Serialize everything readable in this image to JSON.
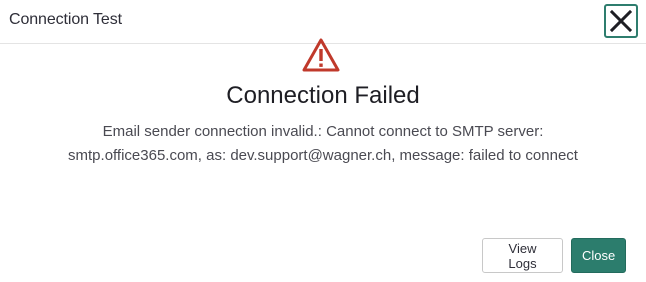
{
  "dialog": {
    "title": "Connection Test",
    "close_icon": "close-x-icon"
  },
  "status": {
    "icon": "warning-triangle-icon",
    "icon_color": "#c0392b",
    "heading": "Connection Failed",
    "message_line1": "Email sender connection invalid.: Cannot connect to SMTP server:",
    "message_line2": "smtp.office365.com, as: dev.support@wagner.ch, message: failed to connect"
  },
  "actions": {
    "view_logs_label": "View Logs",
    "close_label": "Close"
  },
  "colors": {
    "accent": "#2c7d6d",
    "text": "#2e2e38"
  }
}
